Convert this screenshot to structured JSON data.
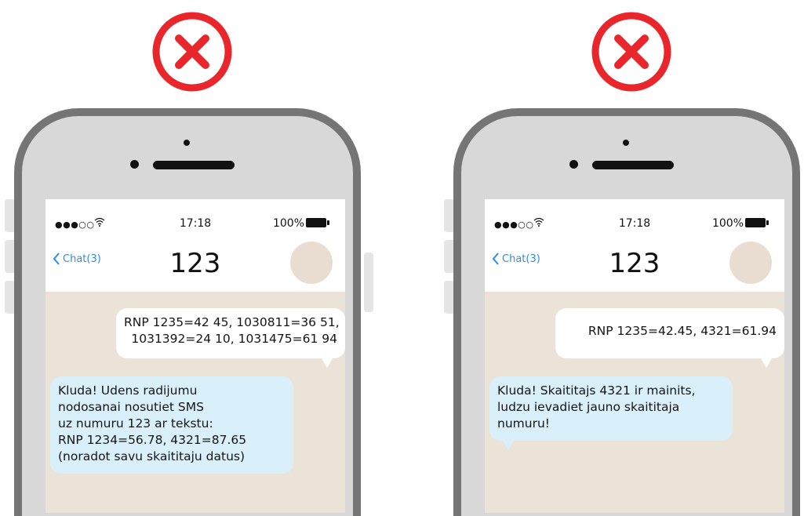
{
  "colors": {
    "error": "#e8262b",
    "link": "#2d8ee0",
    "chat_bg": "#ebe3d8",
    "incoming_bubble": "#d9f0fb",
    "outgoing_bubble": "#ffffff"
  },
  "panels": [
    {
      "badge_icon": "error-x-icon",
      "status": {
        "signal": "●●●○○",
        "time": "17:18",
        "battery": "100%"
      },
      "nav": {
        "back_label": "Chat(3)",
        "title": "123"
      },
      "outgoing": {
        "lines": [
          "RNP 1235=42 45, 1030811=36 51,",
          "1031392=24 10, 1031475=61 94"
        ]
      },
      "incoming": {
        "lines": [
          "Kluda! Udens radijumu",
          "nodosanai nosutiet SMS",
          "uz numuru 123 ar tekstu:",
          "RNP 1234=56.78, 4321=87.65",
          "(noradot savu skaititaju datus)"
        ]
      }
    },
    {
      "badge_icon": "error-x-icon",
      "status": {
        "signal": "●●●○○",
        "time": "17:18",
        "battery": "100%"
      },
      "nav": {
        "back_label": "Chat(3)",
        "title": "123"
      },
      "outgoing": {
        "lines": [
          "RNP 1235=42.45, 4321=61.94"
        ]
      },
      "incoming": {
        "lines": [
          "Kluda! Skaititajs 4321 ir mainits,",
          "ludzu ievadiet jauno skaititaja",
          "numuru!"
        ]
      }
    }
  ]
}
